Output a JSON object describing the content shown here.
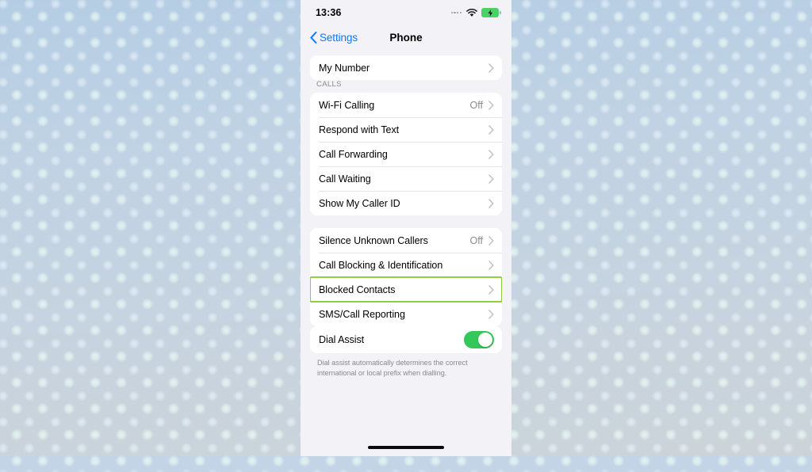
{
  "status_bar": {
    "time": "13:36",
    "signal_icon": "signal-dots-icon",
    "wifi_icon": "wifi-icon",
    "battery_icon": "battery-charging-icon",
    "battery_color": "#4cd264"
  },
  "nav": {
    "back_label": "Settings",
    "back_icon": "chevron-left-icon",
    "title": "Phone",
    "tint_color": "#0a7aff"
  },
  "groups": [
    {
      "header": "",
      "rows": [
        {
          "label": "My Number",
          "value": "",
          "accessory": "chevron",
          "highlighted": false
        }
      ]
    },
    {
      "header": "CALLS",
      "rows": [
        {
          "label": "Wi-Fi Calling",
          "value": "Off",
          "accessory": "chevron",
          "highlighted": false
        },
        {
          "label": "Respond with Text",
          "value": "",
          "accessory": "chevron",
          "highlighted": false
        },
        {
          "label": "Call Forwarding",
          "value": "",
          "accessory": "chevron",
          "highlighted": false
        },
        {
          "label": "Call Waiting",
          "value": "",
          "accessory": "chevron",
          "highlighted": false
        },
        {
          "label": "Show My Caller ID",
          "value": "",
          "accessory": "chevron",
          "highlighted": false
        }
      ]
    },
    {
      "header": "",
      "rows": [
        {
          "label": "Silence Unknown Callers",
          "value": "Off",
          "accessory": "chevron",
          "highlighted": false
        },
        {
          "label": "Call Blocking & Identification",
          "value": "",
          "accessory": "chevron",
          "highlighted": false
        },
        {
          "label": "Blocked Contacts",
          "value": "",
          "accessory": "chevron",
          "highlighted": true
        },
        {
          "label": "SMS/Call Reporting",
          "value": "",
          "accessory": "chevron",
          "highlighted": false
        }
      ]
    },
    {
      "header": "",
      "rows": [
        {
          "label": "Dial Assist",
          "value": "",
          "accessory": "toggle",
          "toggle_on": true,
          "highlighted": false
        }
      ],
      "footer": "Dial assist automatically determines the correct international or local prefix when dialling."
    }
  ],
  "highlight": {
    "color": "#8ed13c",
    "target": "Blocked Contacts"
  },
  "toggle": {
    "on_color": "#34c759",
    "state": "on"
  },
  "home_indicator": "home-indicator-bar"
}
